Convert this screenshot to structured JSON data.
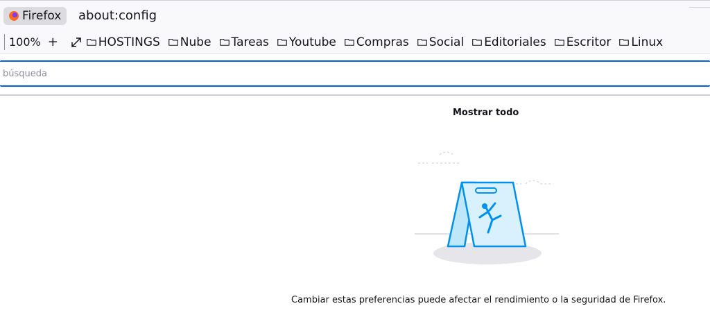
{
  "urlbar": {
    "identity_label": "Firefox",
    "url": "about:config"
  },
  "bookmarks_toolbar": {
    "zoom_level": "100%",
    "zoom_in": "+",
    "items": [
      "HOSTINGS",
      "Nube",
      "Tareas",
      "Youtube",
      "Compras",
      "Social",
      "Editoriales",
      "Escritor",
      "Linux"
    ]
  },
  "search": {
    "placeholder": "búsqueda",
    "value": ""
  },
  "main": {
    "show_all_label": "Mostrar todo",
    "warning_text": "Cambiar estas preferencias puede afectar el rendimiento o la seguridad de Firefox."
  },
  "colors": {
    "accent": "#0061e0",
    "illustration_blue": "#0090ed"
  },
  "icons": {
    "identity": "firefox-logo-icon",
    "expand": "expand-arrows-icon",
    "folder": "folder-icon"
  }
}
